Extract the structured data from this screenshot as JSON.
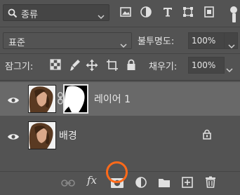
{
  "filter": {
    "label": "종류",
    "icons": [
      "search-icon",
      "image-filter-icon",
      "adjustment-filter-icon",
      "type-filter-icon",
      "shape-filter-icon",
      "smart-object-filter-icon"
    ]
  },
  "blend": {
    "mode": "표준"
  },
  "opacity": {
    "label": "불투명도:",
    "value": "100%"
  },
  "lock": {
    "label": "잠그기:",
    "icons": [
      "lock-transparency-icon",
      "lock-image-icon",
      "lock-position-icon",
      "artboard-icon",
      "lock-all-icon"
    ]
  },
  "fill": {
    "label": "채우기:",
    "value": "100%"
  },
  "layers": [
    {
      "name": "레이어 1",
      "selected": true,
      "has_mask": true
    },
    {
      "name": "배경",
      "locked": true
    }
  ],
  "toolbar": {
    "fx_label": "fx"
  },
  "colors": {
    "panel": "#535353",
    "selected_row": "#696969",
    "highlight": "#ff6a1a"
  }
}
